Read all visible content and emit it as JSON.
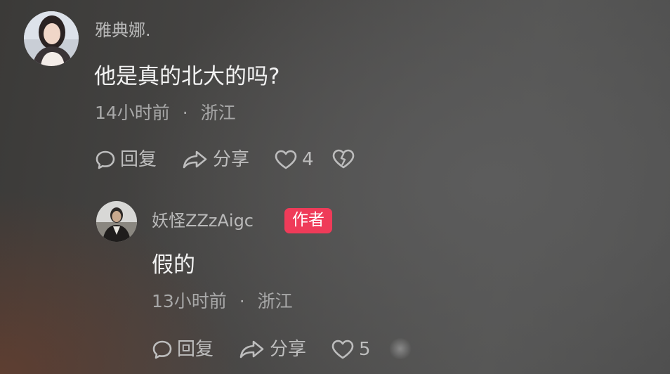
{
  "comments": [
    {
      "username": "雅典娜.",
      "text": "他是真的北大的吗?",
      "time": "14小时前",
      "separator": "·",
      "location": "浙江",
      "reply_label": "回复",
      "share_label": "分享",
      "like_count": "4"
    },
    {
      "username": "妖怪ZZzAigc",
      "badge": "作者",
      "text": "假的",
      "time": "13小时前",
      "separator": "·",
      "location": "浙江",
      "reply_label": "回复",
      "share_label": "分享",
      "like_count": "5"
    }
  ],
  "colors": {
    "badge": "#ef3b59",
    "comment_text": "#f2f2f2",
    "secondary_text": "#b9b9b9"
  }
}
